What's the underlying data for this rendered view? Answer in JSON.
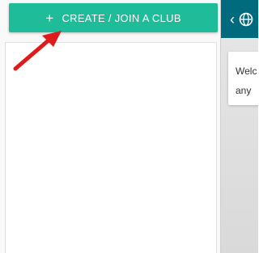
{
  "sidebar": {
    "create_button": {
      "plus_icon": "+",
      "label": "CREATE / JOIN A CLUB",
      "color": "#1ebc98"
    },
    "annotation_arrow": "red-arrow-icon"
  },
  "right_panel": {
    "topbar_color": "#006b7d",
    "back_icon": "‹",
    "welcome_card": {
      "line1": "Welc",
      "line2": "any"
    }
  }
}
